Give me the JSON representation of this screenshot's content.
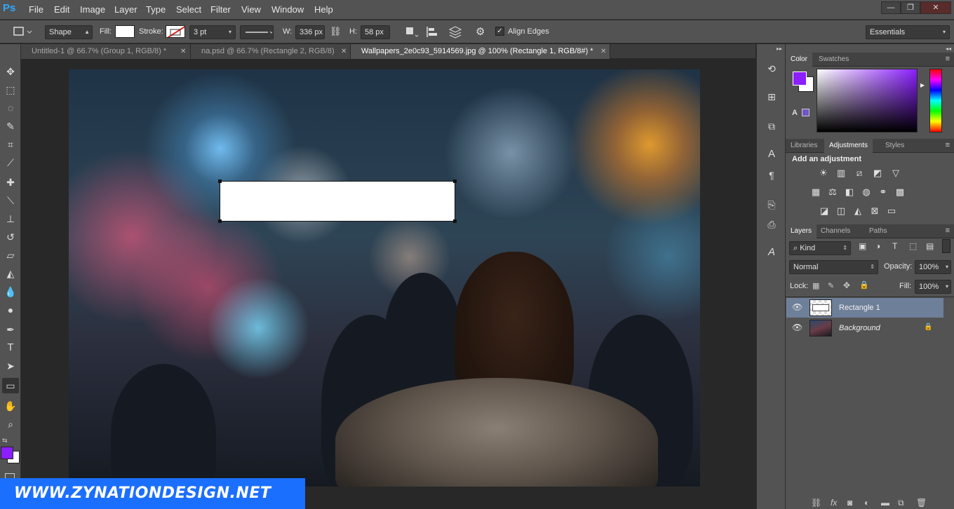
{
  "app": {
    "logo": "Ps"
  },
  "menu": [
    "File",
    "Edit",
    "Image",
    "Layer",
    "Type",
    "Select",
    "Filter",
    "View",
    "Window",
    "Help"
  ],
  "window_controls": {
    "minimize": "—",
    "restore": "❐",
    "close": "✕"
  },
  "options": {
    "shape_mode": "Shape",
    "fill_label": "Fill:",
    "stroke_label": "Stroke:",
    "stroke_width": "3 pt",
    "w_label": "W:",
    "w_value": "336 px",
    "h_label": "H:",
    "h_value": "58 px",
    "align_edges": "Align Edges",
    "align_edges_checked": true,
    "fill_color": "#ffffff",
    "workspace": "Essentials"
  },
  "tabs": [
    {
      "label": "Untitled-1 @ 66.7% (Group 1, RGB/8) *",
      "active": false
    },
    {
      "label": "na.psd @ 66.7% (Rectangle 2, RGB/8)",
      "active": false
    },
    {
      "label": "Wallpapers_2e0c93_5914569.jpg @ 100% (Rectangle 1, RGB/8#) *",
      "active": true
    }
  ],
  "tools": [
    "move-icon",
    "marquee-icon",
    "lasso-icon",
    "quick-select-icon",
    "crop-icon",
    "eyedropper-icon",
    "healing-icon",
    "brush-icon",
    "stamp-icon",
    "history-brush-icon",
    "eraser-icon",
    "paint-bucket-icon",
    "blur-icon",
    "dodge-icon",
    "pen-icon",
    "type-icon",
    "path-select-icon",
    "rectangle-icon",
    "hand-icon",
    "zoom-icon"
  ],
  "colors": {
    "foreground": "#8b1fff",
    "background": "#ffffff",
    "accent": "#1b6fff"
  },
  "color_panel": {
    "tabs": [
      "Color",
      "Swatches"
    ],
    "active": "Color"
  },
  "adjust_panel": {
    "tabs": [
      "Libraries",
      "Adjustments",
      "Styles"
    ],
    "active": "Adjustments",
    "title": "Add an adjustment"
  },
  "layers_panel": {
    "tabs": [
      "Layers",
      "Channels",
      "Paths"
    ],
    "active": "Layers",
    "filter_kind": "Kind",
    "blend_mode": "Normal",
    "opacity_label": "Opacity:",
    "opacity": "100%",
    "lock_label": "Lock:",
    "fill_label": "Fill:",
    "fill": "100%",
    "layers": [
      {
        "name": "Rectangle 1",
        "selected": true,
        "visible": true
      },
      {
        "name": "Background",
        "selected": false,
        "visible": true,
        "locked": true
      }
    ]
  },
  "watermark": "WWW.ZYNATIONDESIGN.NET"
}
